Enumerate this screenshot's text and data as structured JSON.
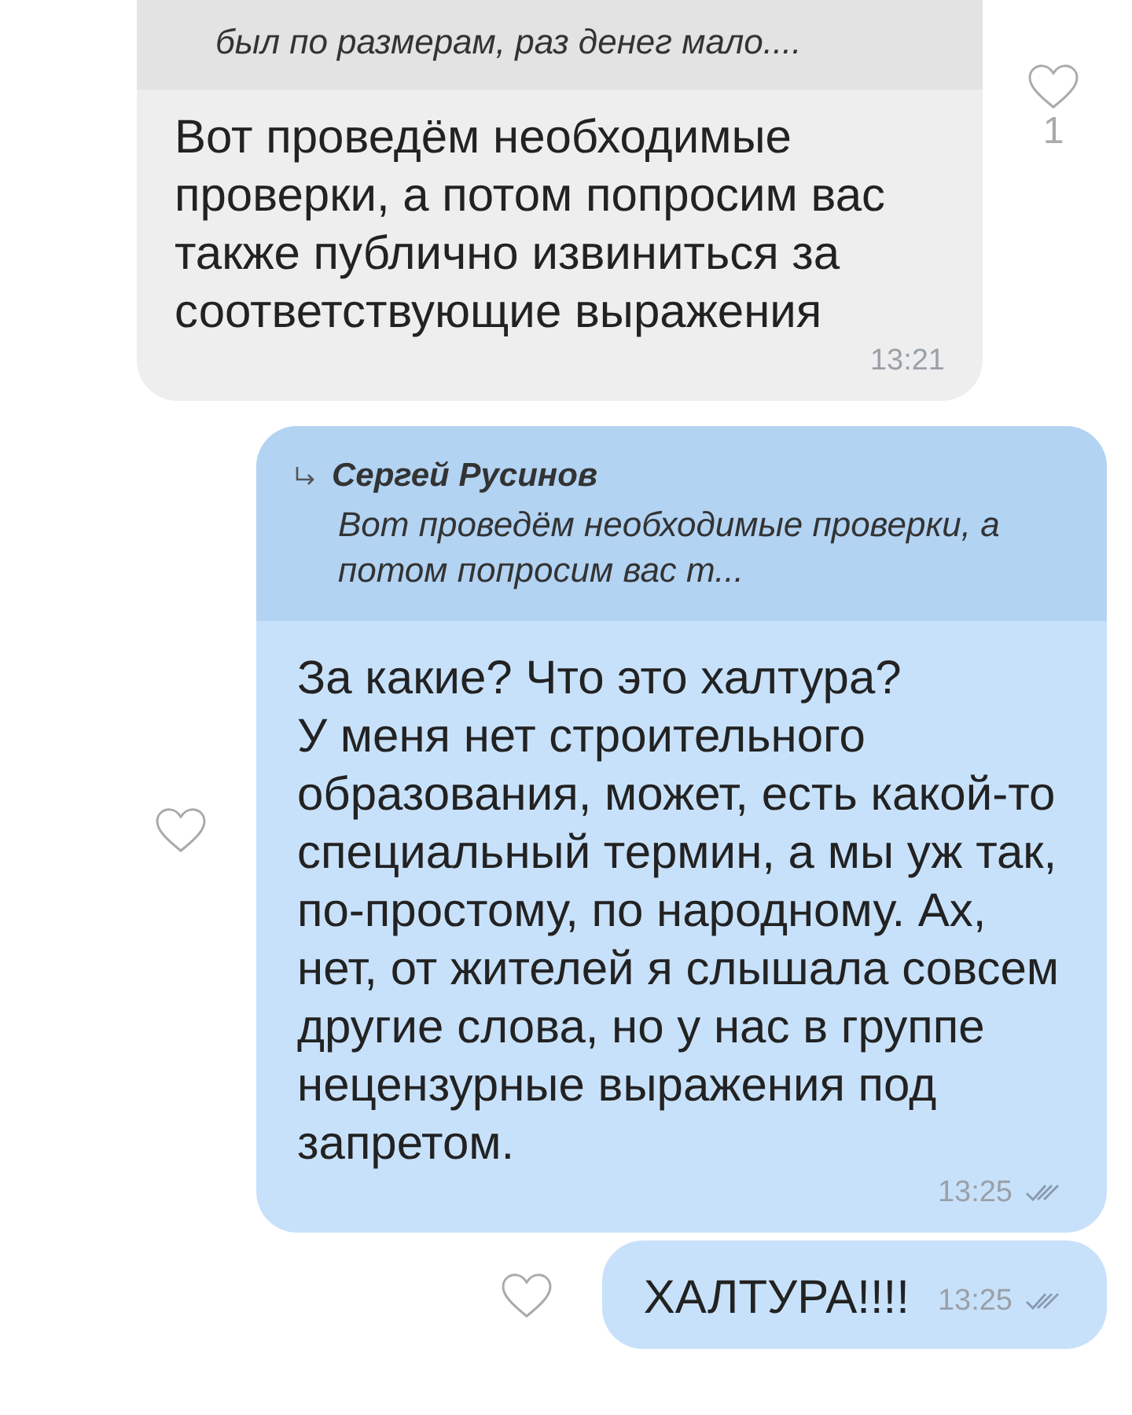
{
  "messages": [
    {
      "kind": "incoming",
      "quote": {
        "text": "был по размерам, раз денег мало...."
      },
      "text": "Вот проведём необходимые проверки, а потом попросим вас также публично извиниться за соответствующие выражения",
      "time": "13:21",
      "like": {
        "liked": false,
        "count": "1"
      }
    },
    {
      "kind": "outgoing",
      "quote": {
        "author": "Сергей Русинов",
        "text": "Вот проведём необходимые проверки, а потом попросим вас т..."
      },
      "text": "За какие? Что это халтура?\nУ меня нет строительного образования, может, есть какой-то специальный термин, а мы уж так, по-простому, по народному. Ах, нет, от жителей я слышала совсем другие слова, но у нас в группе нецензурные выражения под запретом.",
      "time": "13:25",
      "read": true,
      "like": {
        "liked": false
      }
    },
    {
      "kind": "outgoing",
      "inline": true,
      "text": "ХАЛТУРА!!!!",
      "time": "13:25",
      "read": true,
      "like": {
        "liked": false
      }
    }
  ]
}
